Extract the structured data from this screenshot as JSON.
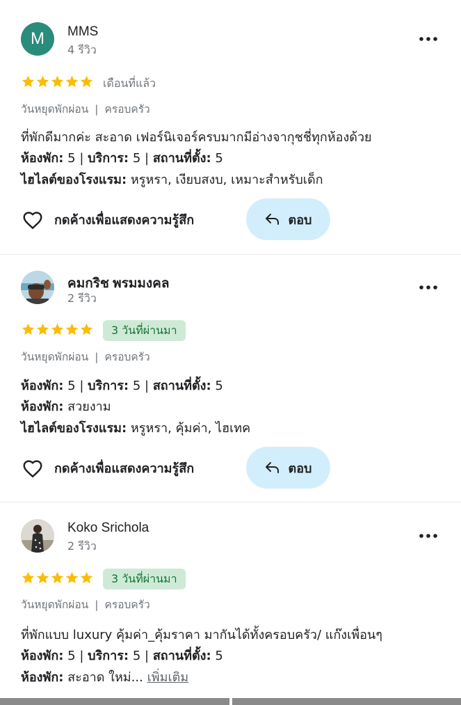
{
  "reviews": [
    {
      "reviewer": {
        "name": "MMS",
        "avatar_letter": "M",
        "review_count": "4 รีวิว"
      },
      "rating": 5,
      "date": "เดือนที่แล้ว",
      "date_is_recent": false,
      "tags": [
        "วันหยุดพักผ่อน",
        "ครอบครัว"
      ],
      "text": "ที่พักดีมากค่ะ สะอาด เฟอร์นิเจอร์ครบมากมีอ่างจากุชชี่ทุกห้องด้วย",
      "ratings_line": {
        "room_label": "ห้องพัก:",
        "room": "5",
        "service_label": "บริการ:",
        "service": "5",
        "location_label": "สถานที่ตั้ง:",
        "location": "5"
      },
      "highlights": {
        "label": "ไฮไลต์ของโรงแรม:",
        "value": "หรูหรา, เงียบสงบ, เหมาะสำหรับเด็ก"
      },
      "like_label": "กดค้างเพื่อแสดงความรู้สึก",
      "reply_label": "ตอบ"
    },
    {
      "reviewer": {
        "name": "คมกริช พรมมงคล",
        "review_count": "2 รีวิว"
      },
      "rating": 5,
      "date": "3 วันที่ผ่านมา",
      "date_is_recent": true,
      "tags": [
        "วันหยุดพักผ่อน",
        "ครอบครัว"
      ],
      "ratings_line": {
        "room_label": "ห้องพัก:",
        "room": "5",
        "service_label": "บริการ:",
        "service": "5",
        "location_label": "สถานที่ตั้ง:",
        "location": "5"
      },
      "room_note": {
        "label": "ห้องพัก:",
        "value": "สวยงาม"
      },
      "highlights": {
        "label": "ไฮไลต์ของโรงแรม:",
        "value": "หรูหรา, คุ้มค่า, ไฮเทค"
      },
      "like_label": "กดค้างเพื่อแสดงความรู้สึก",
      "reply_label": "ตอบ"
    },
    {
      "reviewer": {
        "name": "Koko Srichola",
        "review_count": "2 รีวิว"
      },
      "rating": 5,
      "date": "3 วันที่ผ่านมา",
      "date_is_recent": true,
      "tags": [
        "วันหยุดพักผ่อน",
        "ครอบครัว"
      ],
      "text": "ที่พักแบบ luxury คุ้มค่า_คุ้มราคา มากันได้ทั้งครอบครัว/ แก๊งเพื่อนๆ",
      "ratings_line": {
        "room_label": "ห้องพัก:",
        "room": "5",
        "service_label": "บริการ:",
        "service": "5",
        "location_label": "สถานที่ตั้ง:",
        "location": "5"
      },
      "room_note": {
        "label": "ห้องพัก:",
        "value": "สะอาด ใหม่...",
        "more_link": "เพิ่มเติม"
      }
    }
  ],
  "colors": {
    "star": "#fbbc04",
    "badge_bg": "#ceead6",
    "badge_text": "#137333",
    "reply_bg": "#d2eefc",
    "avatar_m": "#2a8c7a"
  },
  "icons": [
    "more-vert-icon",
    "star-icon",
    "heart-outline-icon",
    "reply-arrow-icon"
  ]
}
